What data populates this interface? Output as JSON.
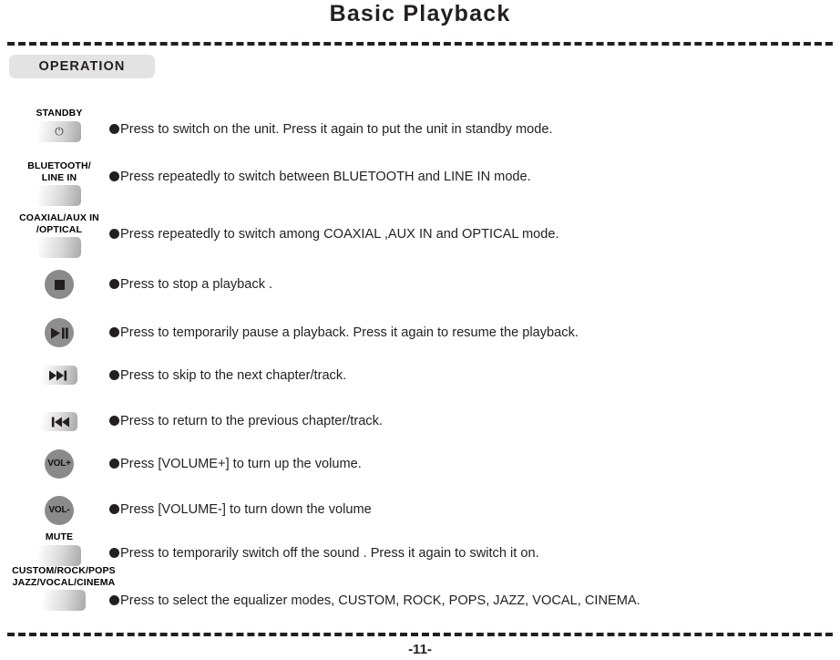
{
  "page": {
    "title": "Basic Playback",
    "section_badge": "OPERATION",
    "page_number": "-11-"
  },
  "colors": {
    "text": "#231f20",
    "badge_background": "#e3e3e3",
    "circle_button": "#8a8a8a",
    "rule": "#231f20"
  },
  "rows": [
    {
      "key_label": "STANDBY",
      "key_type": "rect",
      "key_icon": "power-icon",
      "key_glyph": "⏻",
      "description": "Press to switch on the unit. Press it again to put the unit in standby mode."
    },
    {
      "key_label": "BLUETOOTH/\nLINE IN",
      "key_type": "rect",
      "key_icon": "blank-key-icon",
      "key_glyph": "",
      "description": "Press repeatedly to switch between BLUETOOTH and LINE IN mode."
    },
    {
      "key_label": "COAXIAL/AUX IN\n/OPTICAL",
      "key_type": "rect",
      "key_icon": "blank-key-icon",
      "key_glyph": "",
      "description": "Press repeatedly to switch among COAXIAL ,AUX IN and OPTICAL mode."
    },
    {
      "key_label": "",
      "key_type": "circle-stop",
      "key_icon": "stop-icon",
      "key_glyph": "",
      "description": "Press to stop a playback ."
    },
    {
      "key_label": "",
      "key_type": "circle-playpause",
      "key_icon": "play-pause-icon",
      "key_glyph": "",
      "description": "Press to temporarily pause a playback. Press it again to resume the playback."
    },
    {
      "key_label": "",
      "key_type": "skip",
      "key_icon": "skip-next-icon",
      "key_glyph": "▶▶❘",
      "description": "Press to skip to the next chapter/track."
    },
    {
      "key_label": "",
      "key_type": "skip",
      "key_icon": "skip-previous-icon",
      "key_glyph": "❘◀◀",
      "description": "Press to return to the previous chapter/track."
    },
    {
      "key_label": "",
      "key_type": "circle-text",
      "key_icon": "volume-up-icon",
      "key_glyph": "VOL+",
      "description": "Press [VOLUME+] to turn up the volume."
    },
    {
      "key_label": "",
      "key_type": "circle-text",
      "key_icon": "volume-down-icon",
      "key_glyph": "VOL-",
      "description": "Press [VOLUME-] to turn down the volume"
    },
    {
      "key_label": "MUTE",
      "key_type": "rect",
      "key_icon": "mute-icon",
      "key_glyph": "",
      "description": "Press to temporarily switch off the sound . Press it again to switch it on."
    },
    {
      "key_label": "CUSTOM/ROCK/POPS\nJAZZ/VOCAL/CINEMA",
      "key_type": "rect",
      "key_icon": "equalizer-icon",
      "key_glyph": "",
      "description": "Press to select the equalizer modes, CUSTOM, ROCK, POPS, JAZZ, VOCAL, CINEMA."
    }
  ]
}
